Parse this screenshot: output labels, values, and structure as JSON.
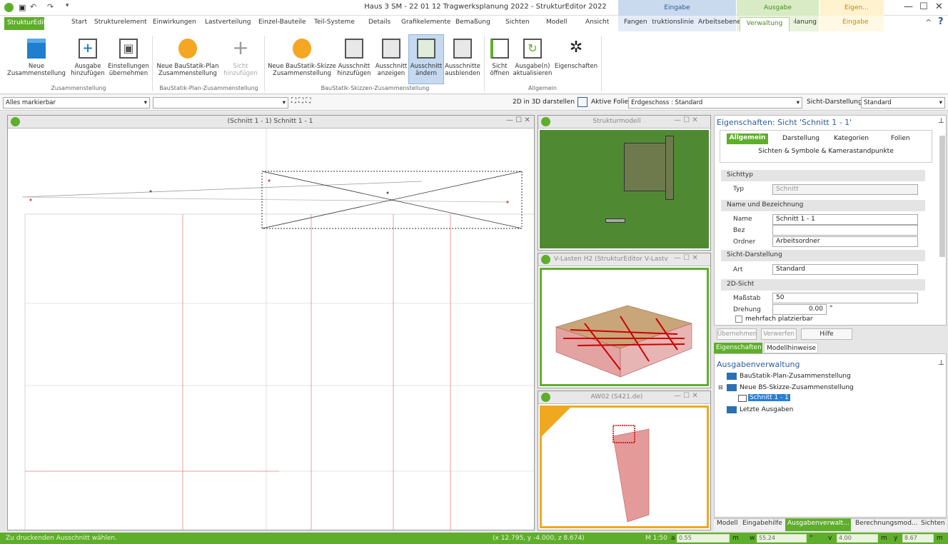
{
  "title": "Haus 3 SM - 22 01 12 Tragwerksplanung 2022 - StrukturEditor 2022",
  "context_groups": {
    "eingabe": "Eingabe",
    "ausgabe": "Ausgabe",
    "eigen": "Eigen..."
  },
  "tabs": [
    "StrukturEditor",
    "Start",
    "Strukturelemente",
    "Einwirkungen",
    "Lastverteilung",
    "Einzel-Bauteile",
    "Teil-Systeme",
    "Details",
    "Grafikelemente",
    "Bemaßung",
    "Sichten",
    "Modell",
    "Ansicht",
    "Fangen",
    "Konstruktionslinie",
    "Arbeitsebene",
    "Verwaltung",
    "Tragwerksplanung",
    "Eingabe"
  ],
  "ribbon": {
    "b1": [
      "Neue",
      "Zusammenstellung"
    ],
    "b2": [
      "Ausgabe",
      "hinzufügen"
    ],
    "b3": [
      "Einstellungen",
      "übernehmen"
    ],
    "b4": [
      "Neue BauStatik-Plan",
      "Zusammenstellung"
    ],
    "b5": [
      "Sicht",
      "hinzufügen"
    ],
    "b6": [
      "Neue BauStatik-Skizze",
      "Zusammenstellung"
    ],
    "b7": [
      "Ausschnitt",
      "hinzufügen"
    ],
    "b8": [
      "Ausschnitt",
      "anzeigen"
    ],
    "b9": [
      "Ausschnitt",
      "ändern"
    ],
    "b10": [
      "Ausschnitte",
      "ausblenden"
    ],
    "b11": [
      "Sicht",
      "öffnen"
    ],
    "b12": [
      "Ausgabe(n)",
      "aktualisieren"
    ],
    "b13": [
      "Eigenschaften",
      ""
    ],
    "g1": "Zusammenstellung",
    "g2": "BauStatik-Plan-Zusammenstellung",
    "g3": "BauStatik-Skizzen-Zusammenstellung",
    "g4": "Allgemein"
  },
  "toolbar": {
    "filter": "Alles markierbar",
    "show3d": "2D in 3D darstellen",
    "folie_label": "Aktive Folie:",
    "folie_value": "Erdgeschoss : Standard",
    "sicht_label": "Sicht-Darstellung:",
    "sicht_value": "Standard"
  },
  "main_view": {
    "title": "(Schnitt 1 - 1) Schnitt 1 - 1"
  },
  "sub_views": {
    "v1": "Strukturmodell",
    "v2": "V-Lasten H2 (StrukturEditor V-Lastv...",
    "v3": "AW02 (S421.de)"
  },
  "properties": {
    "header": "Eigenschaften: Sicht 'Schnitt 1 - 1'",
    "tabs": [
      "Allgemein",
      "Darstellung",
      "Kategorien",
      "Folien"
    ],
    "subtitle": "Sichten & Symbole & Kamerastandpunkte",
    "sec_sichttyp": "Sichttyp",
    "typ_lbl": "Typ",
    "typ_val": "Schnitt",
    "sec_name": "Name und Bezeichnung",
    "name_lbl": "Name",
    "name_val": "Schnitt 1 - 1",
    "bez_lbl": "Bez",
    "ordner_lbl": "Ordner",
    "ordner_val": "Arbeitsordner",
    "sec_darst": "Sicht-Darstellung",
    "art_lbl": "Art",
    "art_val": "Standard",
    "sec_2d": "2D-Sicht",
    "mass_lbl": "Maßstab",
    "mass_val": "50",
    "dreh_lbl": "Drehung",
    "dreh_val": "0.00",
    "dreh_unit": "°",
    "mehrfach": "mehrfach platzierbar"
  },
  "buttons": {
    "ok": "Übernehmen",
    "cancel": "Verwerfen",
    "help": "Hilfe"
  },
  "panel_tabs": [
    "Eigenschaften",
    "Modellhinweise"
  ],
  "tree": {
    "header": "Ausgabenverwaltung",
    "i1": "BauStatik-Plan-Zusammenstellung",
    "i2": "Neue BS-Skizze-Zusammenstellung",
    "i3": "Schnitt 1 - 1",
    "i4": "Letzte Ausgaben"
  },
  "bottom_tabs": [
    "Modell",
    "Eingabehilfe",
    "Ausgabenverwalt...",
    "Berechnungsmod...",
    "Sichten"
  ],
  "status": {
    "msg": "Zu druckenden Ausschnitt wählen.",
    "coords": "(x 12.795, y -4.000, z 8.674)",
    "scale": "M 1:50",
    "a_lbl": "a",
    "a_val": "0.55",
    "w_lbl": "w",
    "w_val": "55.24",
    "v_lbl": "v",
    "v_val": "4.00",
    "y_lbl": "y",
    "y_val": "8.67",
    "m1": "m",
    "deg": "°",
    "m2": "m",
    "m3": "m"
  }
}
